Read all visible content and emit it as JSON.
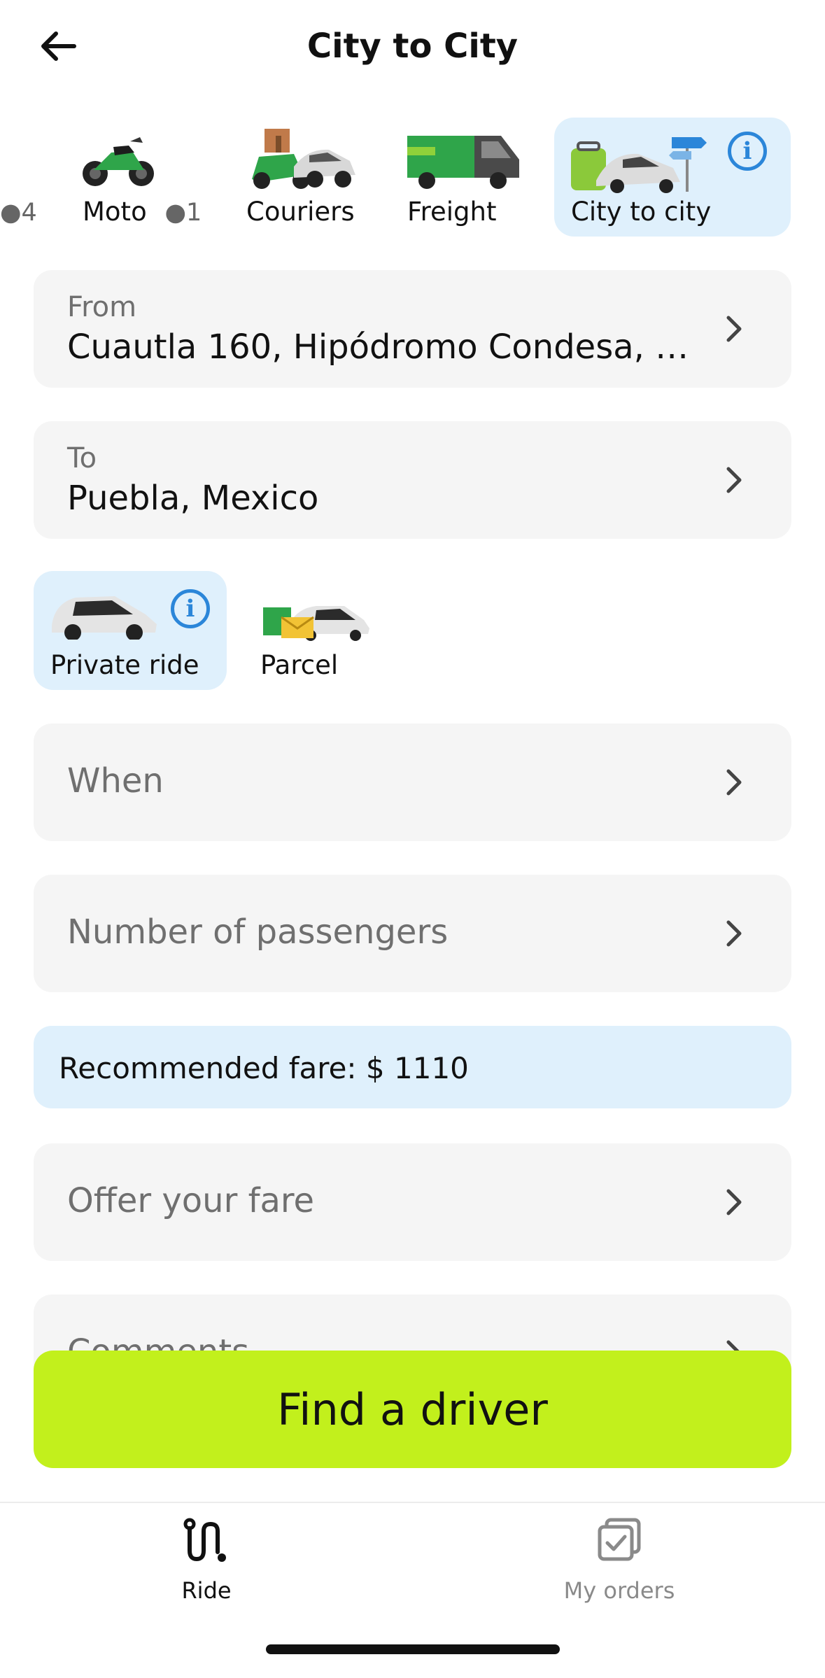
{
  "header": {
    "title": "City to City",
    "back_icon": "arrow-left-icon"
  },
  "categories": [
    {
      "label": "",
      "seats": "4"
    },
    {
      "label": "Moto",
      "seats": "1"
    },
    {
      "label": "Couriers"
    },
    {
      "label": "Freight"
    },
    {
      "label": "City to city",
      "active": true
    }
  ],
  "route": {
    "from_label": "From",
    "from_value": "Cuautla 160, Hipódromo Condesa, M...",
    "to_label": "To",
    "to_value": "Puebla, Mexico"
  },
  "ride_types": [
    {
      "label": "Private ride",
      "active": true
    },
    {
      "label": "Parcel",
      "active": false
    }
  ],
  "options": {
    "when": "When",
    "passengers": "Number of passengers",
    "offer": "Offer your fare",
    "comments": "Comments"
  },
  "fare": {
    "recommended": "Recommended fare: $ 1110"
  },
  "cta": {
    "find_driver": "Find a driver"
  },
  "nav": {
    "ride": "Ride",
    "orders": "My orders"
  },
  "colors": {
    "accent_green": "#c2f01c",
    "info_blue": "#2b86d9",
    "active_bg": "#dff0fc"
  }
}
